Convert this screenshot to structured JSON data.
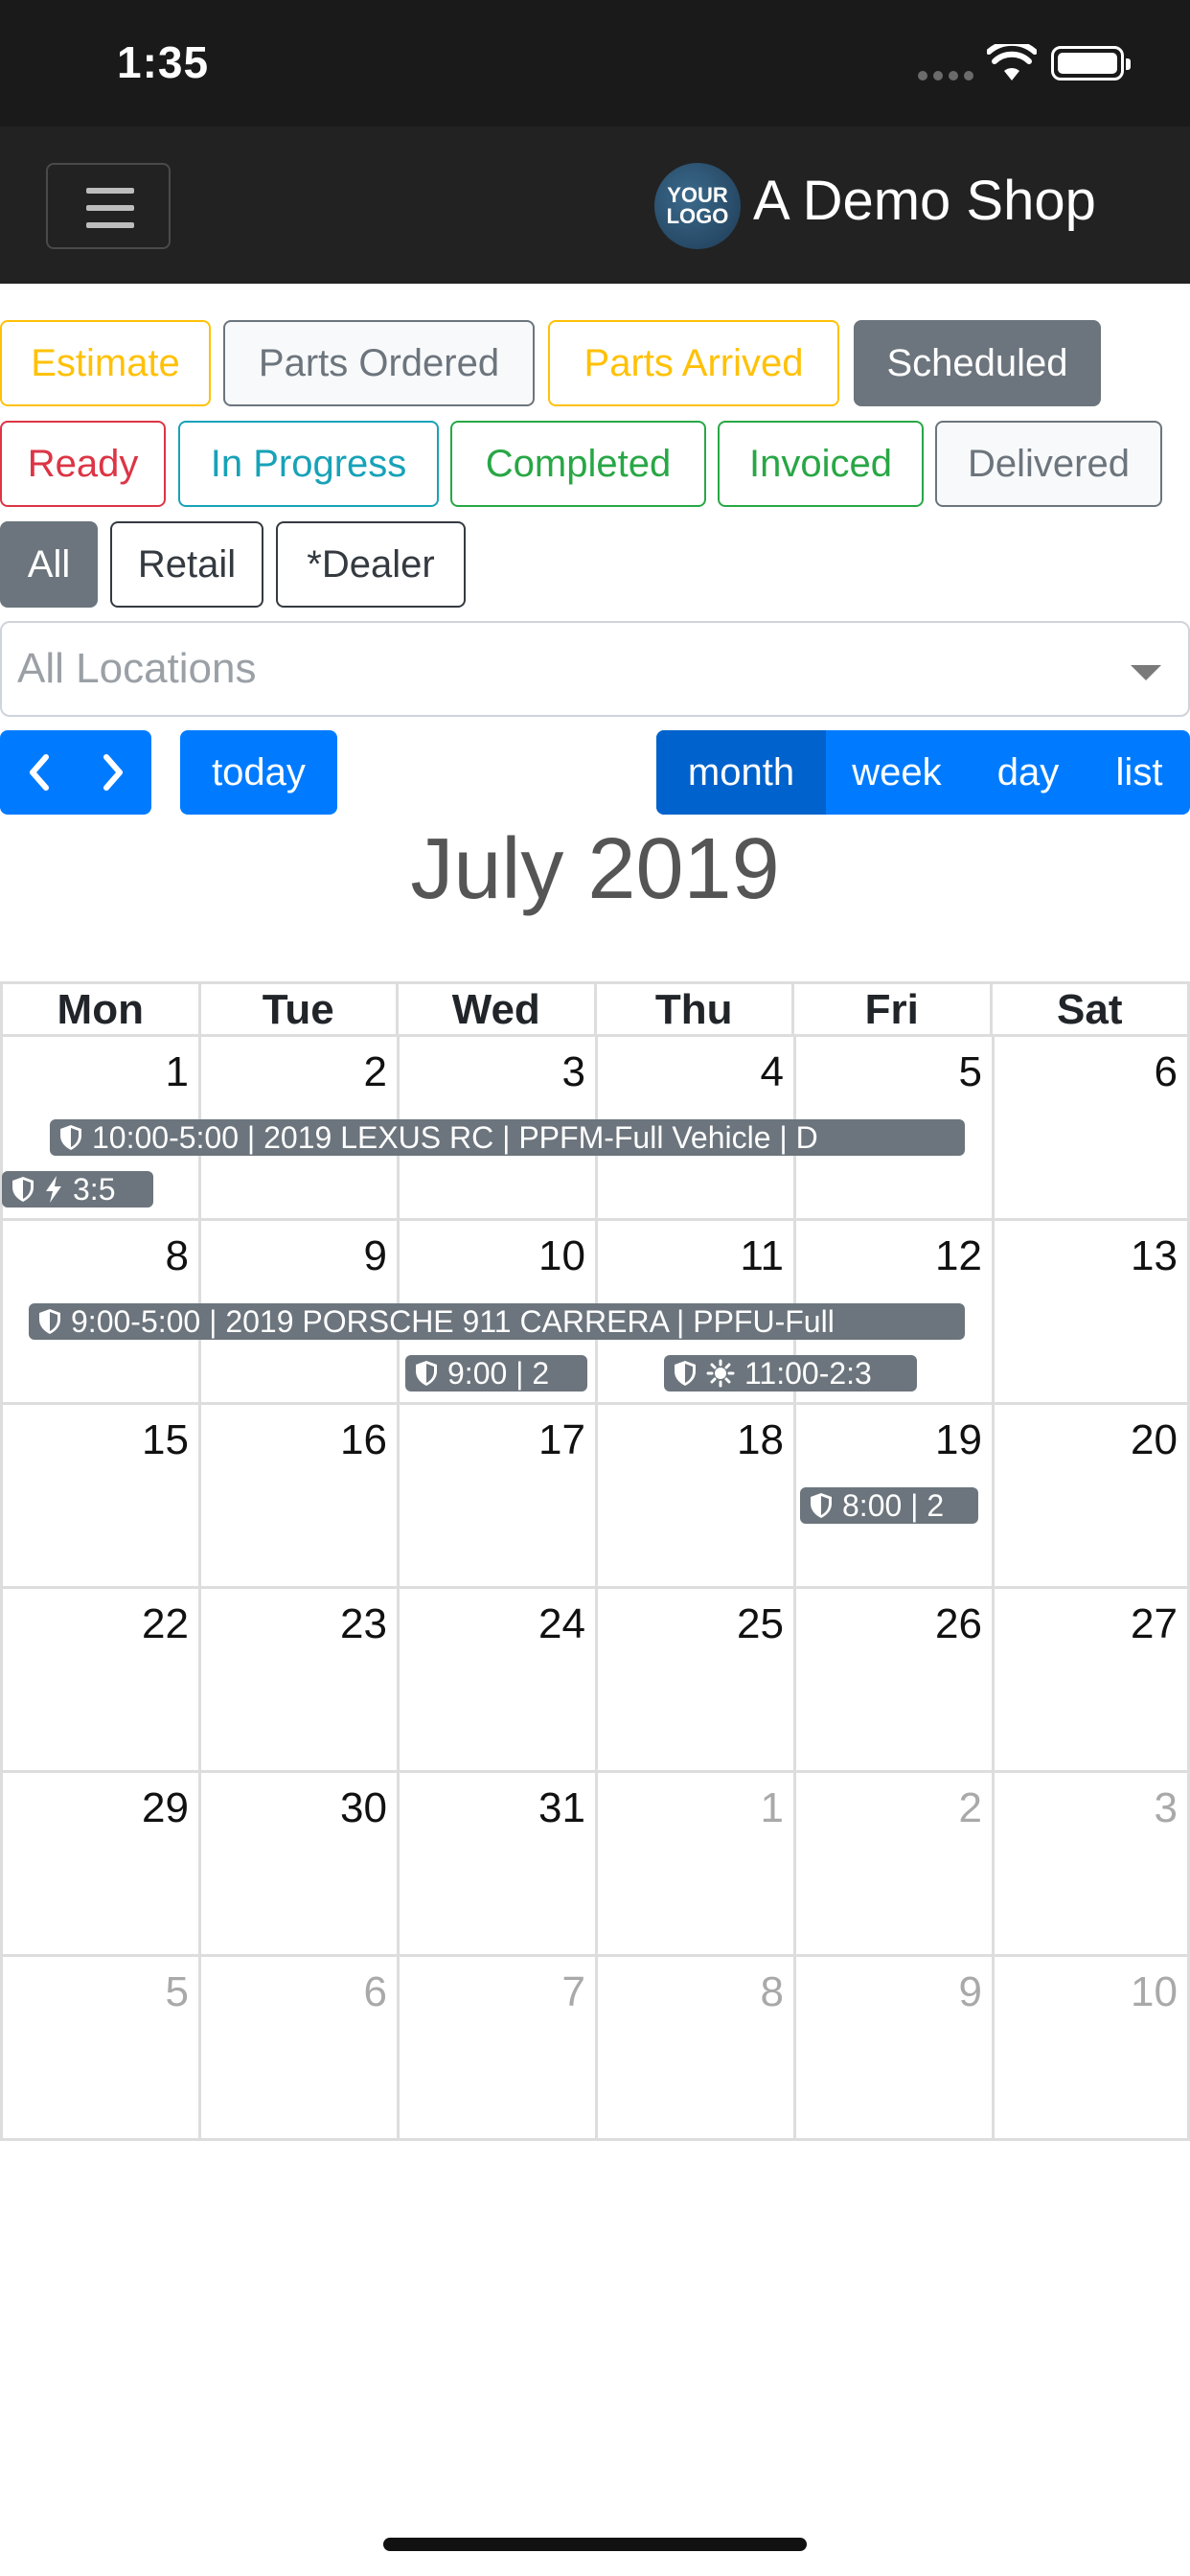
{
  "status_bar": {
    "time": "1:35"
  },
  "navbar": {
    "brand": "A Demo Shop",
    "logo_line1": "YOUR",
    "logo_line2": "LOGO"
  },
  "status_filters": [
    {
      "label": "Estimate"
    },
    {
      "label": "Parts Ordered"
    },
    {
      "label": "Parts Arrived"
    },
    {
      "label": "Scheduled"
    },
    {
      "label": "Ready"
    },
    {
      "label": "In Progress"
    },
    {
      "label": "Completed"
    },
    {
      "label": "Invoiced"
    },
    {
      "label": "Delivered"
    }
  ],
  "customer_filters": [
    {
      "label": "All"
    },
    {
      "label": "Retail"
    },
    {
      "label": "*Dealer"
    }
  ],
  "location_select": {
    "placeholder": "All Locations"
  },
  "toolbar": {
    "prev": "‹",
    "next": "›",
    "today": "today",
    "views": [
      "month",
      "week",
      "day",
      "list"
    ],
    "active_view": "month"
  },
  "calendar": {
    "title": "July 2019",
    "weekdays": [
      "Mon",
      "Tue",
      "Wed",
      "Thu",
      "Fri",
      "Sat"
    ],
    "weeks": [
      [
        "1",
        "2",
        "3",
        "4",
        "5",
        "6"
      ],
      [
        "8",
        "9",
        "10",
        "11",
        "12",
        "13"
      ],
      [
        "15",
        "16",
        "17",
        "18",
        "19",
        "20"
      ],
      [
        "22",
        "23",
        "24",
        "25",
        "26",
        "27"
      ],
      [
        "29",
        "30",
        "31",
        "1",
        "2",
        "3"
      ],
      [
        "5",
        "6",
        "7",
        "8",
        "9",
        "10"
      ]
    ],
    "events": [
      {
        "text": "10:00-5:00 | 2019 LEXUS RC | PPFM-Full Vehicle | D",
        "icons": [
          "shield"
        ]
      },
      {
        "text": "3:5",
        "icons": [
          "shield",
          "bolt"
        ]
      },
      {
        "text": "9:00-5:00 | 2019 PORSCHE 911 CARRERA | PPFU-Full",
        "icons": [
          "shield"
        ]
      },
      {
        "text": "9:00 | 2",
        "icons": [
          "shield"
        ]
      },
      {
        "text": "11:00-2:3",
        "icons": [
          "shield",
          "sun"
        ]
      },
      {
        "text": "8:00 | 2",
        "icons": [
          "shield"
        ]
      }
    ]
  },
  "colors": {
    "primary": "#007bff",
    "primary_active": "#0062cc",
    "event": "#6c757d",
    "navbar": "#222222",
    "warning": "#ffc107",
    "danger": "#dc3545",
    "info": "#17a2b8",
    "success": "#28a745"
  }
}
